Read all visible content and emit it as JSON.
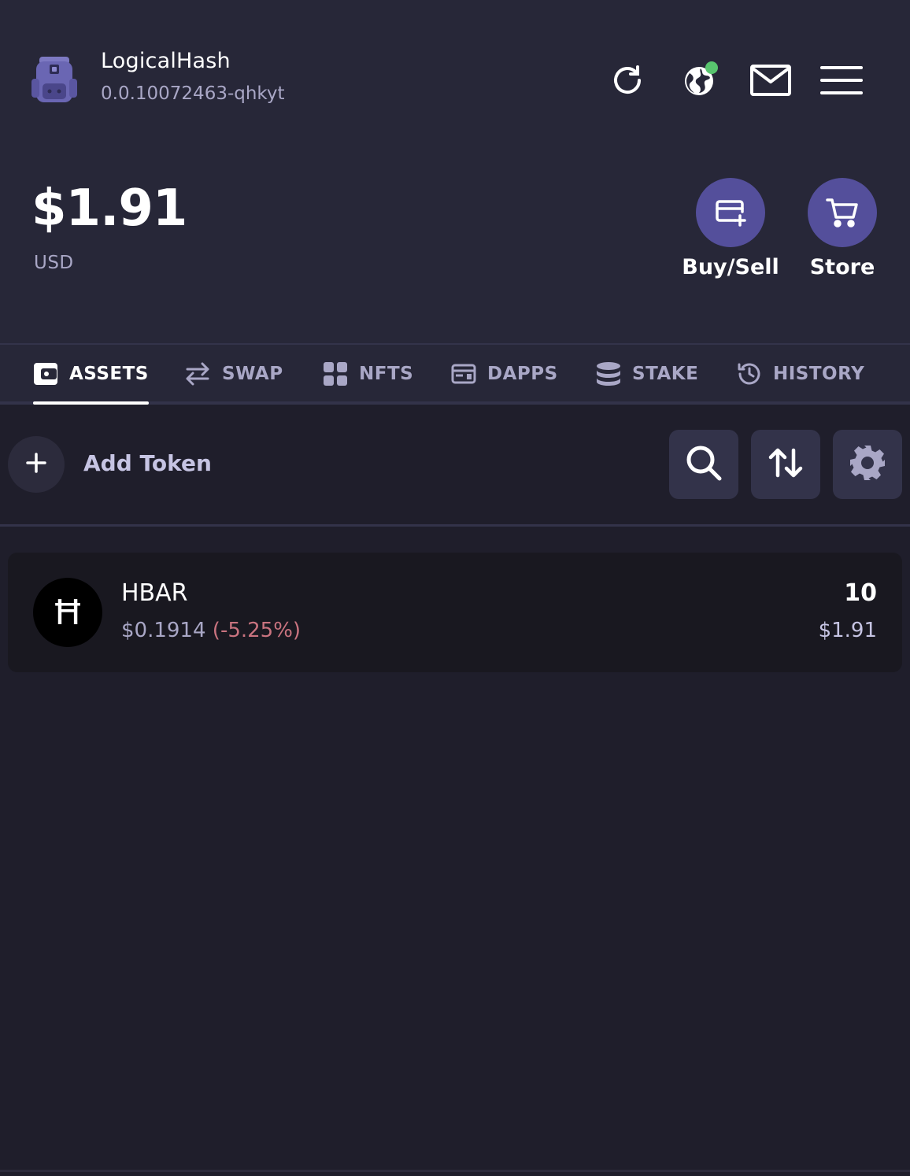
{
  "account": {
    "name": "LogicalHash",
    "id": "0.0.10072463-qhkyt"
  },
  "header_icons": [
    "refresh-icon",
    "globe-icon",
    "mail-icon",
    "menu-icon"
  ],
  "network_status_color": "#58c46e",
  "balance": {
    "amount": "$1.91",
    "currency": "USD"
  },
  "actions": [
    {
      "label": "Buy/Sell",
      "icon": "card-plus-icon"
    },
    {
      "label": "Store",
      "icon": "cart-icon"
    }
  ],
  "tabs": [
    {
      "label": "ASSETS",
      "icon": "wallet-icon",
      "active": true
    },
    {
      "label": "SWAP",
      "icon": "swap-icon",
      "active": false
    },
    {
      "label": "NFTS",
      "icon": "grid-icon",
      "active": false
    },
    {
      "label": "DAPPS",
      "icon": "dapps-icon",
      "active": false
    },
    {
      "label": "STAKE",
      "icon": "stack-icon",
      "active": false
    },
    {
      "label": "HISTORY",
      "icon": "history-icon",
      "active": false
    }
  ],
  "toolbar": {
    "add_token_label": "Add Token",
    "tools": [
      "search-icon",
      "sort-icon",
      "gear-icon"
    ]
  },
  "tokens": [
    {
      "logo_letter": "Ħ",
      "symbol": "HBAR",
      "price": "$0.1914",
      "change": "(-5.25%)",
      "amount": "10",
      "value": "$1.91"
    }
  ],
  "colors": {
    "accent": "#544f9b",
    "background": "#1f1e2b",
    "header": "#272738",
    "negative_change": "#c9737f"
  }
}
